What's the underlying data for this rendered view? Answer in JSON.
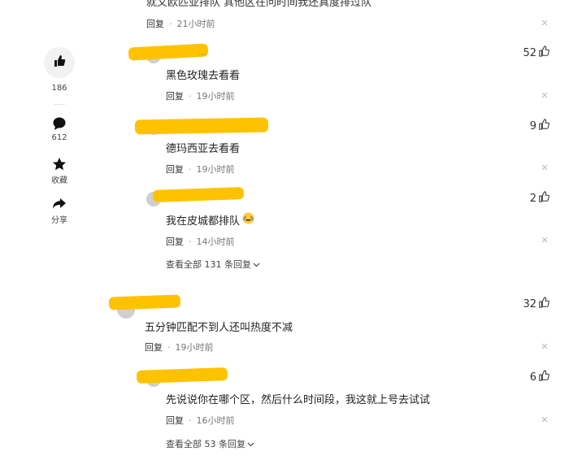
{
  "top_comment": {
    "text": "就又欧匹亚排队 其他区在问时间我还真度排过队"
  },
  "top_meta": {
    "reply": "回复",
    "time": "21小时前"
  },
  "rail": {
    "like_count": "186",
    "comment_count": "612",
    "favorite_label": "收藏",
    "share_label": "分享"
  },
  "replies_a": [
    {
      "name_frag": "…",
      "text": "黑色玫瑰去看看",
      "reply": "回复",
      "time": "19小时前",
      "likes": "52"
    },
    {
      "name_frag": "…",
      "text": "德玛西亚去看看",
      "reply": "回复",
      "time": "19小时前",
      "likes": "9"
    },
    {
      "name_frag": "…",
      "text": "我在皮城都排队",
      "reply": "回复",
      "time": "14小时前",
      "likes": "2"
    }
  ],
  "view_all_a": "查看全部 131 条回复",
  "comment_main": {
    "text": "五分钟匹配不到人还叫热度不减",
    "reply": "回复",
    "time": "19小时前",
    "likes": "32"
  },
  "replies_b": [
    {
      "text": "先说说你在哪个区，然后什么时间段，我这就上号去试试",
      "reply": "回复",
      "time": "16小时前",
      "likes": "6"
    }
  ],
  "view_all_b": "查看全部 53 条回复",
  "colors": {
    "redaction": "#ffc200",
    "rail_bg": "#f2f2f2"
  }
}
